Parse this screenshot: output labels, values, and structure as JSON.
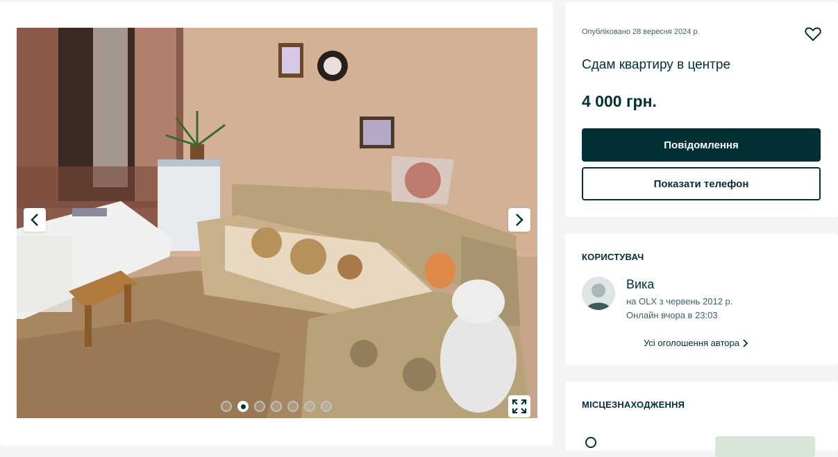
{
  "gallery": {
    "image_alt": "Apartment room photo",
    "dot_count": 7,
    "active_dot": 1
  },
  "listing": {
    "posted": "Опубліковано 28 вересня 2024 р.",
    "title": "Сдам квартиру в центре",
    "price": "4 000 грн.",
    "message_button": "Повідомлення",
    "phone_button": "Показати телефон"
  },
  "user": {
    "section_title": "КОРИСТУВАЧ",
    "name": "Вика",
    "since": "на OLX з червень 2012 р.",
    "online": "Онлайн вчора в 23:03",
    "all_ads_link": "Усі оголошення автора"
  },
  "location": {
    "section_title": "МІСЦЕЗНАХОДЖЕННЯ"
  },
  "colors": {
    "primary": "#002f34",
    "muted": "#406367",
    "background": "#f2f4f5"
  },
  "icons": [
    "chevron-left-icon",
    "chevron-right-icon",
    "heart-icon",
    "fullscreen-icon",
    "chevron-right-small-icon",
    "location-pin-icon"
  ]
}
